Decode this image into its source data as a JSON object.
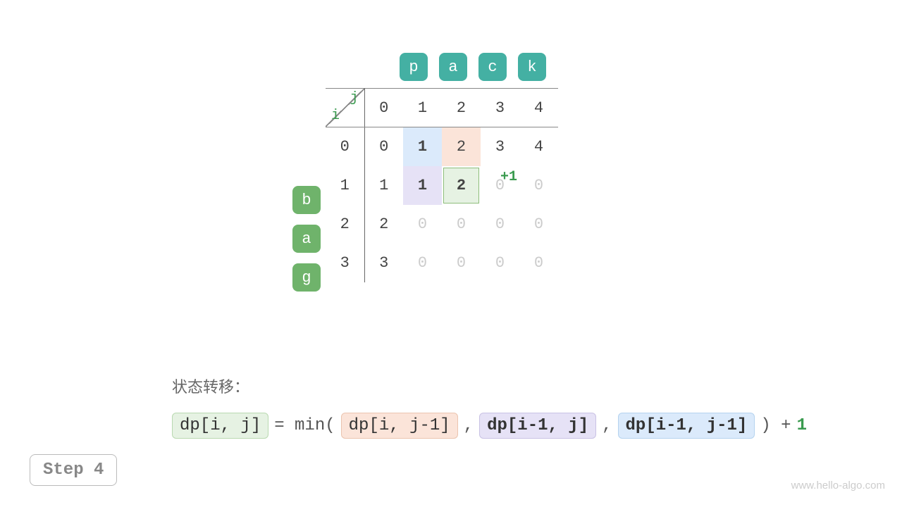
{
  "topChars": [
    "p",
    "a",
    "c",
    "k"
  ],
  "sideChars": [
    "b",
    "a",
    "g"
  ],
  "axis": {
    "i": "i",
    "j": "j"
  },
  "colHeaders": [
    "0",
    "1",
    "2",
    "3",
    "4"
  ],
  "rowHeaders": [
    "0",
    "1",
    "2",
    "3"
  ],
  "annotation": "+1",
  "grid": [
    [
      {
        "v": "0"
      },
      {
        "v": "1",
        "cls": "hl-blue bold"
      },
      {
        "v": "2",
        "cls": "hl-orange"
      },
      {
        "v": "3"
      },
      {
        "v": "4"
      }
    ],
    [
      {
        "v": "1"
      },
      {
        "v": "1",
        "cls": "hl-lav bold"
      },
      {
        "v": "2",
        "cls": "bold",
        "box": true
      },
      {
        "v": "0",
        "cls": "faded"
      },
      {
        "v": "0",
        "cls": "faded"
      }
    ],
    [
      {
        "v": "2"
      },
      {
        "v": "0",
        "cls": "faded"
      },
      {
        "v": "0",
        "cls": "faded"
      },
      {
        "v": "0",
        "cls": "faded"
      },
      {
        "v": "0",
        "cls": "faded"
      }
    ],
    [
      {
        "v": "3"
      },
      {
        "v": "0",
        "cls": "faded"
      },
      {
        "v": "0",
        "cls": "faded"
      },
      {
        "v": "0",
        "cls": "faded"
      },
      {
        "v": "0",
        "cls": "faded"
      }
    ]
  ],
  "formula": {
    "title": "状态转移：",
    "lhs": "dp[i, j]",
    "eq": " = min( ",
    "t1": "dp[i, j-1]",
    "c1": " , ",
    "t2": "dp[i-1, j]",
    "c2": " , ",
    "t3": "dp[i-1, j-1]",
    "close": " ) + ",
    "one": "1"
  },
  "step": "Step 4",
  "watermark": "www.hello-algo.com"
}
